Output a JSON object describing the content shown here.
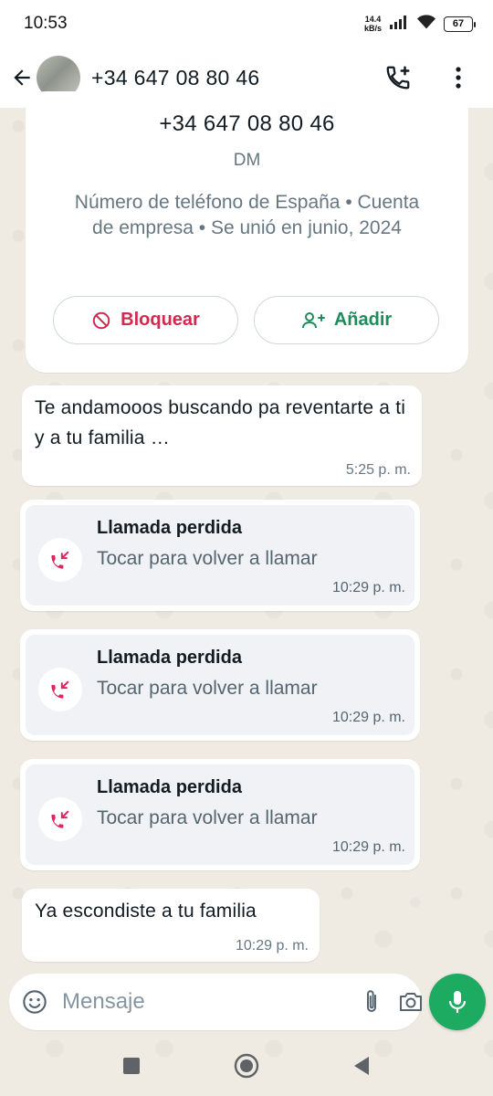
{
  "status_bar": {
    "time": "10:53",
    "net_speed_value": "14.4",
    "net_speed_unit": "kB/s",
    "battery": "67"
  },
  "header": {
    "title": "+34 647 08 80 46",
    "icons": [
      "back-arrow-icon",
      "add-call-icon",
      "more-vert-icon"
    ]
  },
  "info_card": {
    "number": "+34 647 08 80 46",
    "label": "DM",
    "description": "Número de teléfono de España • Cuenta de empresa • Se unió en junio, 2024",
    "block_label": "Bloquear",
    "add_label": "Añadir"
  },
  "messages": [
    {
      "text": "Te andamooos buscando pa reventarte a ti y a tu familia …",
      "time": "5:25 p. m."
    },
    {
      "text": "Ya escondiste a tu familia",
      "time": "10:29 p. m."
    }
  ],
  "missed_calls": [
    {
      "title": "Llamada perdida",
      "subtitle": "Tocar para volver a llamar",
      "time": "10:29 p. m."
    },
    {
      "title": "Llamada perdida",
      "subtitle": "Tocar para volver a llamar",
      "time": "10:29 p. m."
    },
    {
      "title": "Llamada perdida",
      "subtitle": "Tocar para volver a llamar",
      "time": "10:29 p. m."
    }
  ],
  "composer": {
    "placeholder": "Mensaje"
  },
  "colors": {
    "accent_green": "#1daa61",
    "block_red": "#d3294e",
    "add_green": "#1c8c5b",
    "missed_call_red": "#e0245e",
    "chat_background": "#efeae2"
  }
}
